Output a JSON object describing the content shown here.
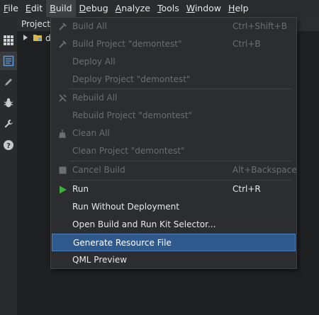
{
  "menubar": {
    "items": [
      {
        "label": "File",
        "mnemonic": "F",
        "rest": "ile"
      },
      {
        "label": "Edit",
        "mnemonic": "E",
        "rest": "dit"
      },
      {
        "label": "Build",
        "mnemonic": "B",
        "rest": "uild"
      },
      {
        "label": "Debug",
        "mnemonic": "D",
        "rest": "ebug"
      },
      {
        "label": "Analyze",
        "mnemonic": "A",
        "rest": "nalyze"
      },
      {
        "label": "Tools",
        "mnemonic": "T",
        "rest": "ools"
      },
      {
        "label": "Window",
        "mnemonic": "W",
        "rest": "indow"
      },
      {
        "label": "Help",
        "mnemonic": "H",
        "rest": "elp"
      }
    ]
  },
  "modebar": {
    "icons": [
      "welcome-grid-icon",
      "edit-document-icon",
      "design-pen-icon",
      "debug-bug-icon",
      "projects-wrench-icon",
      "help-question-icon"
    ]
  },
  "pane": {
    "title": "Projects",
    "tree_first": "d"
  },
  "build_menu": {
    "items": [
      {
        "label": "Build All",
        "shortcut": "Ctrl+Shift+B",
        "enabled": false,
        "icon": "hammer-icon"
      },
      {
        "label": "Build Project \"demontest\"",
        "shortcut": "Ctrl+B",
        "enabled": false,
        "icon": "hammer-icon"
      },
      {
        "label": "Deploy All",
        "shortcut": "",
        "enabled": false
      },
      {
        "label": "Deploy Project \"demontest\"",
        "shortcut": "",
        "enabled": false
      },
      {
        "label": "Rebuild All",
        "shortcut": "",
        "enabled": false,
        "icon": "rebuild-icon"
      },
      {
        "label": "Rebuild Project \"demontest\"",
        "shortcut": "",
        "enabled": false
      },
      {
        "label": "Clean All",
        "shortcut": "",
        "enabled": false,
        "icon": "clean-broom-icon"
      },
      {
        "label": "Clean Project \"demontest\"",
        "shortcut": "",
        "enabled": false
      },
      {
        "label": "Cancel Build",
        "shortcut": "Alt+Backspace",
        "enabled": false,
        "icon": "stop-icon"
      },
      {
        "label": "Run",
        "shortcut": "Ctrl+R",
        "enabled": true,
        "icon": "run-play-icon"
      },
      {
        "label": "Run Without Deployment",
        "shortcut": "",
        "enabled": true
      },
      {
        "label": "Open Build and Run Kit Selector...",
        "shortcut": "",
        "enabled": true
      },
      {
        "label": "Generate Resource File",
        "shortcut": "",
        "enabled": true,
        "highlighted": true
      },
      {
        "label": "QML Preview",
        "shortcut": "",
        "enabled": true
      }
    ]
  },
  "colors": {
    "accent_highlight": "#2f5a8e",
    "run_green": "#3fb13a",
    "disabled_text": "#6b6e72"
  }
}
